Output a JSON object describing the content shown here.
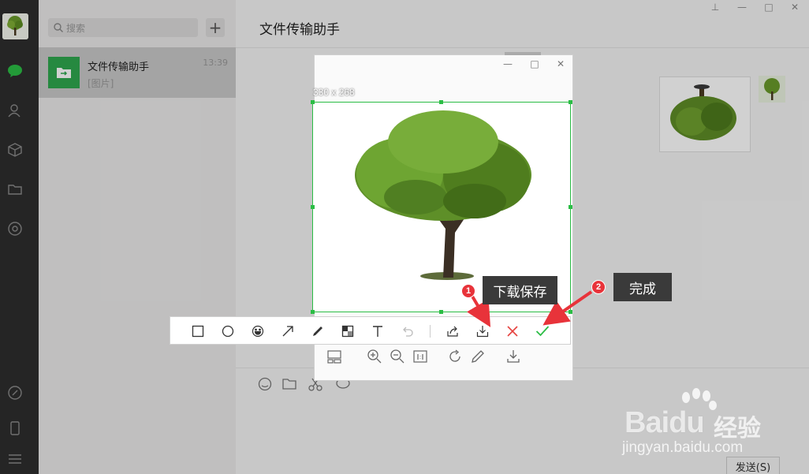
{
  "nav": {
    "avatar_icon": "tree-avatar",
    "icons": [
      "chat-icon",
      "contacts-icon",
      "box-icon",
      "folder-icon",
      "moments-icon",
      "link-icon",
      "phone-icon",
      "menu-icon"
    ]
  },
  "list": {
    "search_placeholder": "搜索",
    "add_label": "+",
    "chat": {
      "name": "文件传输助手",
      "time": "13:39",
      "preview": "[图片]"
    }
  },
  "main": {
    "title": "文件传输助手",
    "send_label": "发送(S)"
  },
  "capture": {
    "size_label": "330 x 268",
    "accent_color": "#2bbd45"
  },
  "toolbar": {
    "buttons": [
      "rectangle-tool",
      "ellipse-tool",
      "emoji-tool",
      "arrow-tool",
      "pen-tool",
      "mosaic-tool",
      "text-tool",
      "undo-button",
      "share-button",
      "download-save-button",
      "cancel-button",
      "finish-button"
    ]
  },
  "annotations": {
    "step1_number": "1",
    "step1_label": "下载保存",
    "step2_number": "2",
    "step2_label": "完成",
    "arrow_color": "#e8333a"
  }
}
